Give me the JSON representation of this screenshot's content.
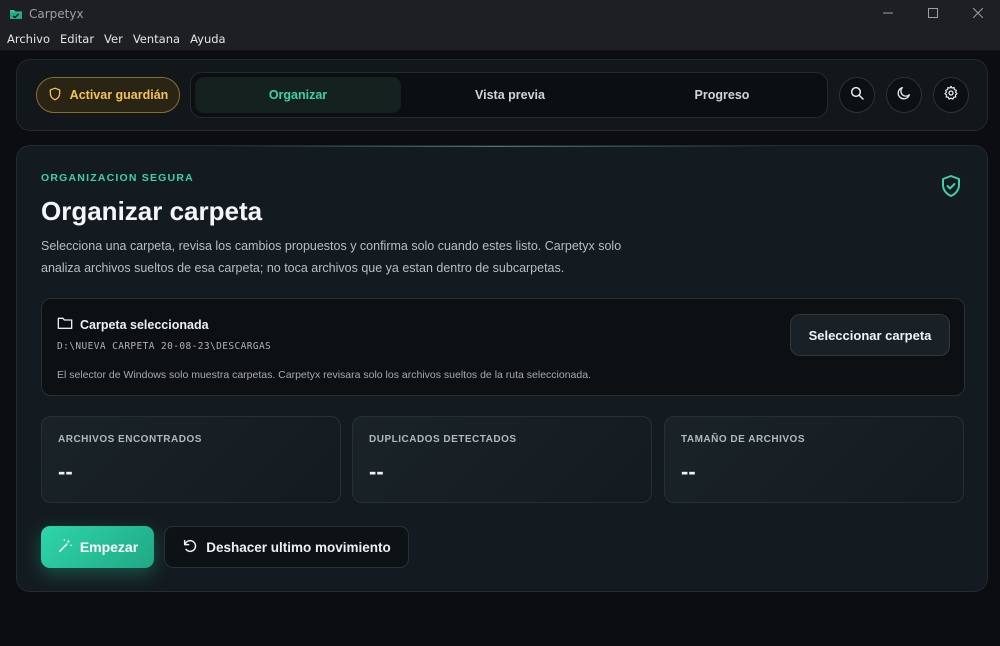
{
  "window": {
    "title": "Carpetyx",
    "controls": {
      "minimize_icon": "minimize-icon",
      "maximize_icon": "maximize-icon",
      "close_icon": "close-icon"
    }
  },
  "menu": [
    "Archivo",
    "Editar",
    "Ver",
    "Ventana",
    "Ayuda"
  ],
  "header": {
    "guardian_label": "Activar guardián",
    "tabs": [
      {
        "label": "Organizar",
        "active": true
      },
      {
        "label": "Vista previa",
        "active": false
      },
      {
        "label": "Progreso",
        "active": false
      }
    ],
    "icons": [
      "search-icon",
      "moon-icon",
      "gear-icon"
    ]
  },
  "main": {
    "eyebrow": "ORGANIZACION SEGURA",
    "title": "Organizar carpeta",
    "description": "Selecciona una carpeta, revisa los cambios propuestos y confirma solo cuando estes listo. Carpetyx solo analiza archivos sueltos de esa carpeta; no toca archivos que ya estan dentro de subcarpetas.",
    "folder": {
      "label": "Carpeta seleccionada",
      "path": "D:\\NUEVA CARPETA 20-08-23\\DESCARGAS",
      "hint": "El selector de Windows solo muestra carpetas. Carpetyx revisara solo los archivos sueltos de la ruta seleccionada.",
      "button": "Seleccionar carpeta"
    },
    "stats": [
      {
        "label": "ARCHIVOS ENCONTRADOS",
        "value": "--"
      },
      {
        "label": "DUPLICADOS DETECTADOS",
        "value": "--"
      },
      {
        "label": "TAMAÑO DE ARCHIVOS",
        "value": "--"
      }
    ],
    "actions": {
      "start": "Empezar",
      "undo": "Deshacer ultimo movimiento"
    }
  },
  "colors": {
    "accent": "#3fd0a8",
    "guardian": "#f3c358",
    "background": "#0b0d10"
  }
}
